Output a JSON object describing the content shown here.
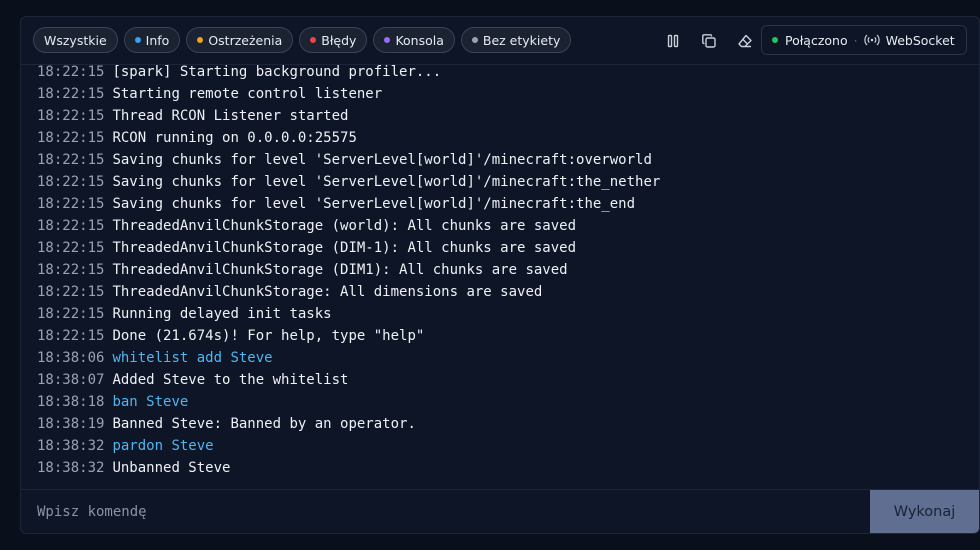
{
  "filters": [
    {
      "label": "Wszystkie",
      "dot": null
    },
    {
      "label": "Info",
      "dot": "#3b9ef0"
    },
    {
      "label": "Ostrzeżenia",
      "dot": "#f0a020"
    },
    {
      "label": "Błędy",
      "dot": "#ef4444"
    },
    {
      "label": "Konsola",
      "dot": "#9b6cf5"
    },
    {
      "label": "Bez etykiety",
      "dot": "#9aa3b2"
    }
  ],
  "status": {
    "connection_label": "Połączono",
    "connection_color": "#22c55e",
    "separator": "·",
    "transport_label": "WebSocket"
  },
  "colors": {
    "command_text": "#4fb6f0",
    "output_text": "#eef1f5",
    "timestamp_text": "#9aa3b2"
  },
  "log": [
    {
      "time": "18:22:15",
      "text": "[spark] Starting background profiler...",
      "kind": "output"
    },
    {
      "time": "18:22:15",
      "text": "Starting remote control listener",
      "kind": "output"
    },
    {
      "time": "18:22:15",
      "text": "Thread RCON Listener started",
      "kind": "output"
    },
    {
      "time": "18:22:15",
      "text": "RCON running on 0.0.0.0:25575",
      "kind": "output"
    },
    {
      "time": "18:22:15",
      "text": "Saving chunks for level 'ServerLevel[world]'/minecraft:overworld",
      "kind": "output"
    },
    {
      "time": "18:22:15",
      "text": "Saving chunks for level 'ServerLevel[world]'/minecraft:the_nether",
      "kind": "output"
    },
    {
      "time": "18:22:15",
      "text": "Saving chunks for level 'ServerLevel[world]'/minecraft:the_end",
      "kind": "output"
    },
    {
      "time": "18:22:15",
      "text": "ThreadedAnvilChunkStorage (world): All chunks are saved",
      "kind": "output"
    },
    {
      "time": "18:22:15",
      "text": "ThreadedAnvilChunkStorage (DIM-1): All chunks are saved",
      "kind": "output"
    },
    {
      "time": "18:22:15",
      "text": "ThreadedAnvilChunkStorage (DIM1): All chunks are saved",
      "kind": "output"
    },
    {
      "time": "18:22:15",
      "text": "ThreadedAnvilChunkStorage: All dimensions are saved",
      "kind": "output"
    },
    {
      "time": "18:22:15",
      "text": "Running delayed init tasks",
      "kind": "output"
    },
    {
      "time": "18:22:15",
      "text": "Done (21.674s)! For help, type \"help\"",
      "kind": "output"
    },
    {
      "time": "18:38:06",
      "text": "whitelist add Steve",
      "kind": "command"
    },
    {
      "time": "18:38:07",
      "text": "Added Steve to the whitelist",
      "kind": "output"
    },
    {
      "time": "18:38:18",
      "text": "ban Steve",
      "kind": "command"
    },
    {
      "time": "18:38:19",
      "text": "Banned Steve: Banned by an operator.",
      "kind": "output"
    },
    {
      "time": "18:38:32",
      "text": "pardon Steve",
      "kind": "command"
    },
    {
      "time": "18:38:32",
      "text": "Unbanned Steve",
      "kind": "output"
    }
  ],
  "input": {
    "placeholder": "Wpisz komendę",
    "value": ""
  },
  "execute_label": "Wykonaj",
  "icons": {
    "pause": "pause-icon",
    "copy": "copy-icon",
    "clear": "eraser-icon",
    "websocket": "broadcast-icon"
  }
}
